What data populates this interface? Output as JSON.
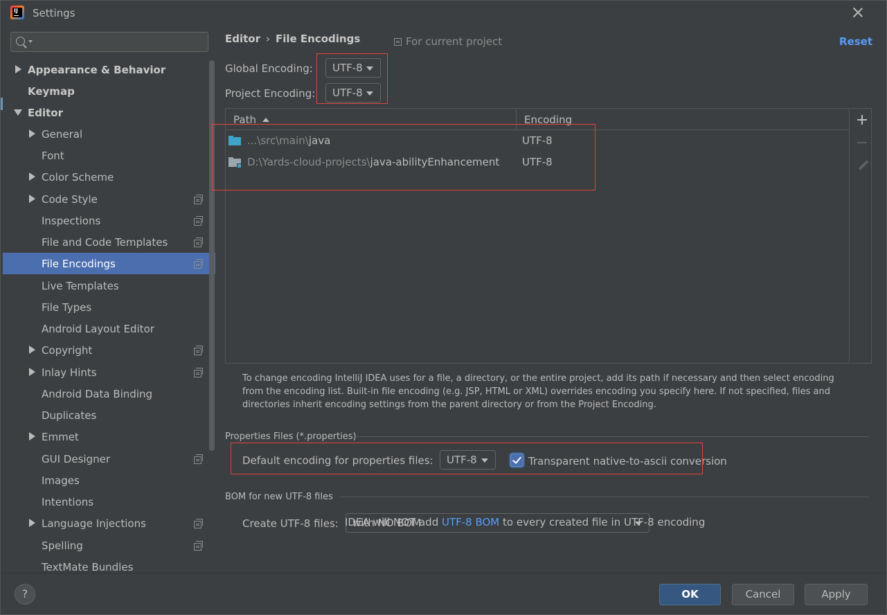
{
  "window": {
    "title": "Settings"
  },
  "search": {
    "placeholder": "",
    "value": ""
  },
  "sidebar": {
    "items": [
      {
        "label": "Appearance & Behavior"
      },
      {
        "label": "Keymap"
      },
      {
        "label": "Editor"
      },
      {
        "label": "General"
      },
      {
        "label": "Font"
      },
      {
        "label": "Color Scheme"
      },
      {
        "label": "Code Style"
      },
      {
        "label": "Inspections"
      },
      {
        "label": "File and Code Templates"
      },
      {
        "label": "File Encodings"
      },
      {
        "label": "Live Templates"
      },
      {
        "label": "File Types"
      },
      {
        "label": "Android Layout Editor"
      },
      {
        "label": "Copyright"
      },
      {
        "label": "Inlay Hints"
      },
      {
        "label": "Android Data Binding"
      },
      {
        "label": "Duplicates"
      },
      {
        "label": "Emmet"
      },
      {
        "label": "GUI Designer"
      },
      {
        "label": "Images"
      },
      {
        "label": "Intentions"
      },
      {
        "label": "Language Injections"
      },
      {
        "label": "Spelling"
      },
      {
        "label": "TextMate Bundles"
      }
    ]
  },
  "header": {
    "crumb_parent": "Editor",
    "crumb_sep": "›",
    "crumb_current": "File Encodings",
    "scope": "For current project",
    "reset": "Reset"
  },
  "encodings": {
    "global_label": "Global Encoding:",
    "global_value": "UTF-8",
    "project_label": "Project Encoding:",
    "project_value": "UTF-8"
  },
  "table": {
    "col_path": "Path",
    "col_encoding": "Encoding",
    "rows": [
      {
        "path_prefix": "...\\src\\main\\",
        "path_name": "java",
        "encoding": "UTF-8"
      },
      {
        "path_prefix": "D:\\Yards-cloud-projects\\",
        "path_name": "java-abilityEnhancement",
        "encoding": "UTF-8"
      }
    ]
  },
  "help_text": "To change encoding IntelliJ IDEA uses for a file, a directory, or the entire project, add its path if necessary and then select encoding from the encoding list. Built-in file encoding (e.g. JSP, HTML or XML) overrides encoding you specify here. If not specified, files and directories inherit encoding settings from the parent directory or from the Project Encoding.",
  "properties": {
    "section_title": "Properties Files (*.properties)",
    "default_label": "Default encoding for properties files:",
    "default_value": "UTF-8",
    "transparent_label": "Transparent native-to-ascii conversion",
    "transparent_checked": true
  },
  "bom": {
    "section_title": "BOM for new UTF-8 files",
    "create_label": "Create UTF-8 files:",
    "create_value": "with NO BOM",
    "note_before": "IDEA will NOT add ",
    "note_link": "UTF-8 BOM",
    "note_after": " to every created file in UTF-8 encoding"
  },
  "footer": {
    "help": "?",
    "ok": "OK",
    "cancel": "Cancel",
    "apply": "Apply"
  },
  "colors": {
    "background": "#3c3f41",
    "selection": "#4b6eaf",
    "link": "#589df6",
    "highlight_box": "#e0443a",
    "primary_button": "#365880"
  }
}
